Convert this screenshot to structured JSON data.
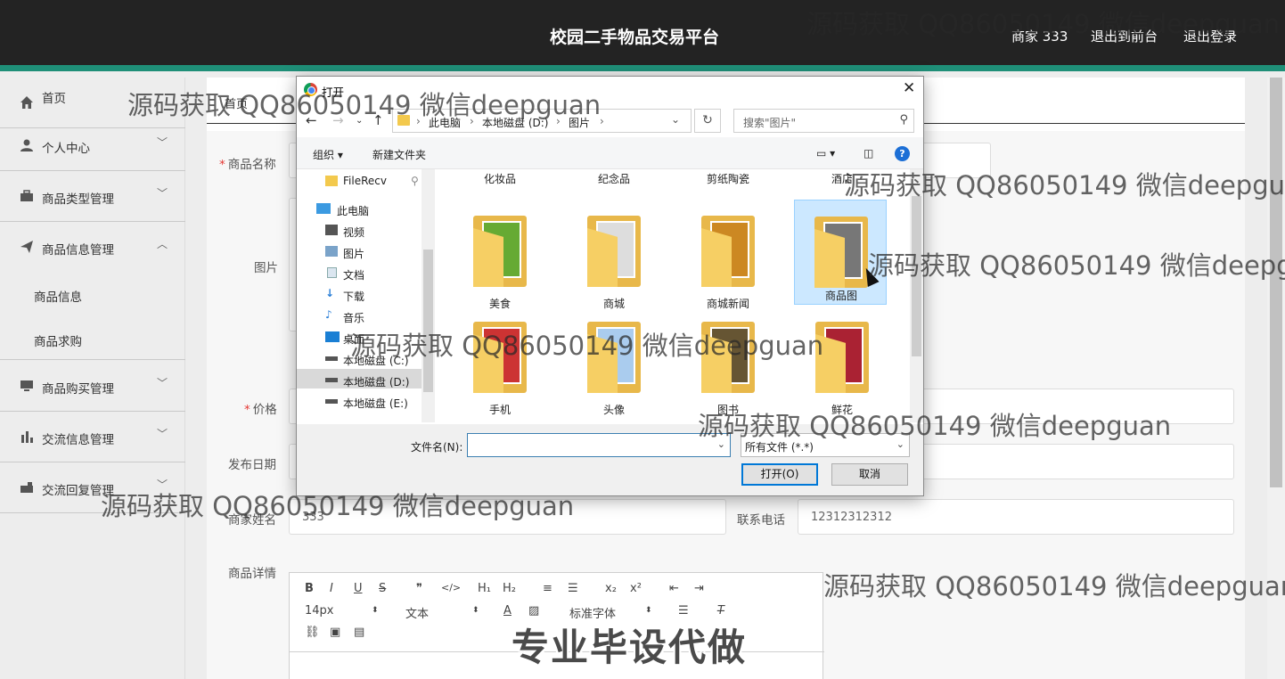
{
  "header": {
    "title": "校园二手物品交易平台",
    "user": "商家 333",
    "back_front": "退出到前台",
    "logout": "退出登录"
  },
  "sidebar": {
    "items": [
      {
        "label": "首页",
        "icon": "home-icon"
      },
      {
        "label": "个人中心",
        "icon": "user-icon"
      },
      {
        "label": "商品类型管理",
        "icon": "briefcase-icon"
      },
      {
        "label": "商品信息管理",
        "icon": "send-icon"
      },
      {
        "label": "商品购买管理",
        "icon": "monitor-icon"
      },
      {
        "label": "交流信息管理",
        "icon": "bar-chart-icon"
      },
      {
        "label": "交流回复管理",
        "icon": "toolbox-icon"
      }
    ],
    "sub_items": [
      "商品信息",
      "商品求购"
    ]
  },
  "breadcrumb": {
    "home": "首页"
  },
  "form": {
    "name_label": "商品名称",
    "image_label": "图片",
    "price_label": "价格",
    "date_label": "发布日期",
    "merchant_label": "商家姓名",
    "merchant_value": "333",
    "phone_label": "联系电话",
    "phone_value": "12312312312",
    "detail_label": "商品详情"
  },
  "editor": {
    "font_size": "14px",
    "paragraph": "文本",
    "font_family": "标准字体",
    "tools_row1": [
      "B",
      "I",
      "U",
      "S",
      "❞",
      "</>",
      "H₁",
      "H₂",
      "≡",
      "☰",
      "x₂",
      "x²",
      "⇤",
      "⇥"
    ]
  },
  "dialog": {
    "title": "打开",
    "path": [
      "此电脑",
      "本地磁盘 (D:)",
      "图片"
    ],
    "search_placeholder": "搜索\"图片\"",
    "organize": "组织 ▾",
    "new_folder": "新建文件夹",
    "tree": [
      {
        "label": "FileRecv",
        "icon": "folder-icon"
      },
      {
        "label": "此电脑",
        "icon": "computer-icon"
      },
      {
        "label": "视频",
        "icon": "video-icon"
      },
      {
        "label": "图片",
        "icon": "pictures-icon"
      },
      {
        "label": "文档",
        "icon": "documents-icon"
      },
      {
        "label": "下载",
        "icon": "download-icon"
      },
      {
        "label": "音乐",
        "icon": "music-icon"
      },
      {
        "label": "桌面",
        "icon": "desktop-icon"
      },
      {
        "label": "本地磁盘 (C:)",
        "icon": "drive-icon"
      },
      {
        "label": "本地磁盘 (D:)",
        "icon": "drive-icon"
      },
      {
        "label": "本地磁盘 (E:)",
        "icon": "drive-icon"
      }
    ],
    "folders": [
      "化妆品",
      "纪念品",
      "剪纸陶瓷",
      "酒店",
      "美食",
      "商城",
      "商城新闻",
      "商品图",
      "手机",
      "头像",
      "图书",
      "鲜花"
    ],
    "selected_folder": "商品图",
    "filename_label": "文件名(N):",
    "filename_value": "",
    "filter": "所有文件 (*.*)",
    "open_button": "打开(O)",
    "cancel_button": "取消"
  },
  "watermark": "源码获取 QQ86050149 微信deepguan",
  "banner": "专业毕设代做"
}
